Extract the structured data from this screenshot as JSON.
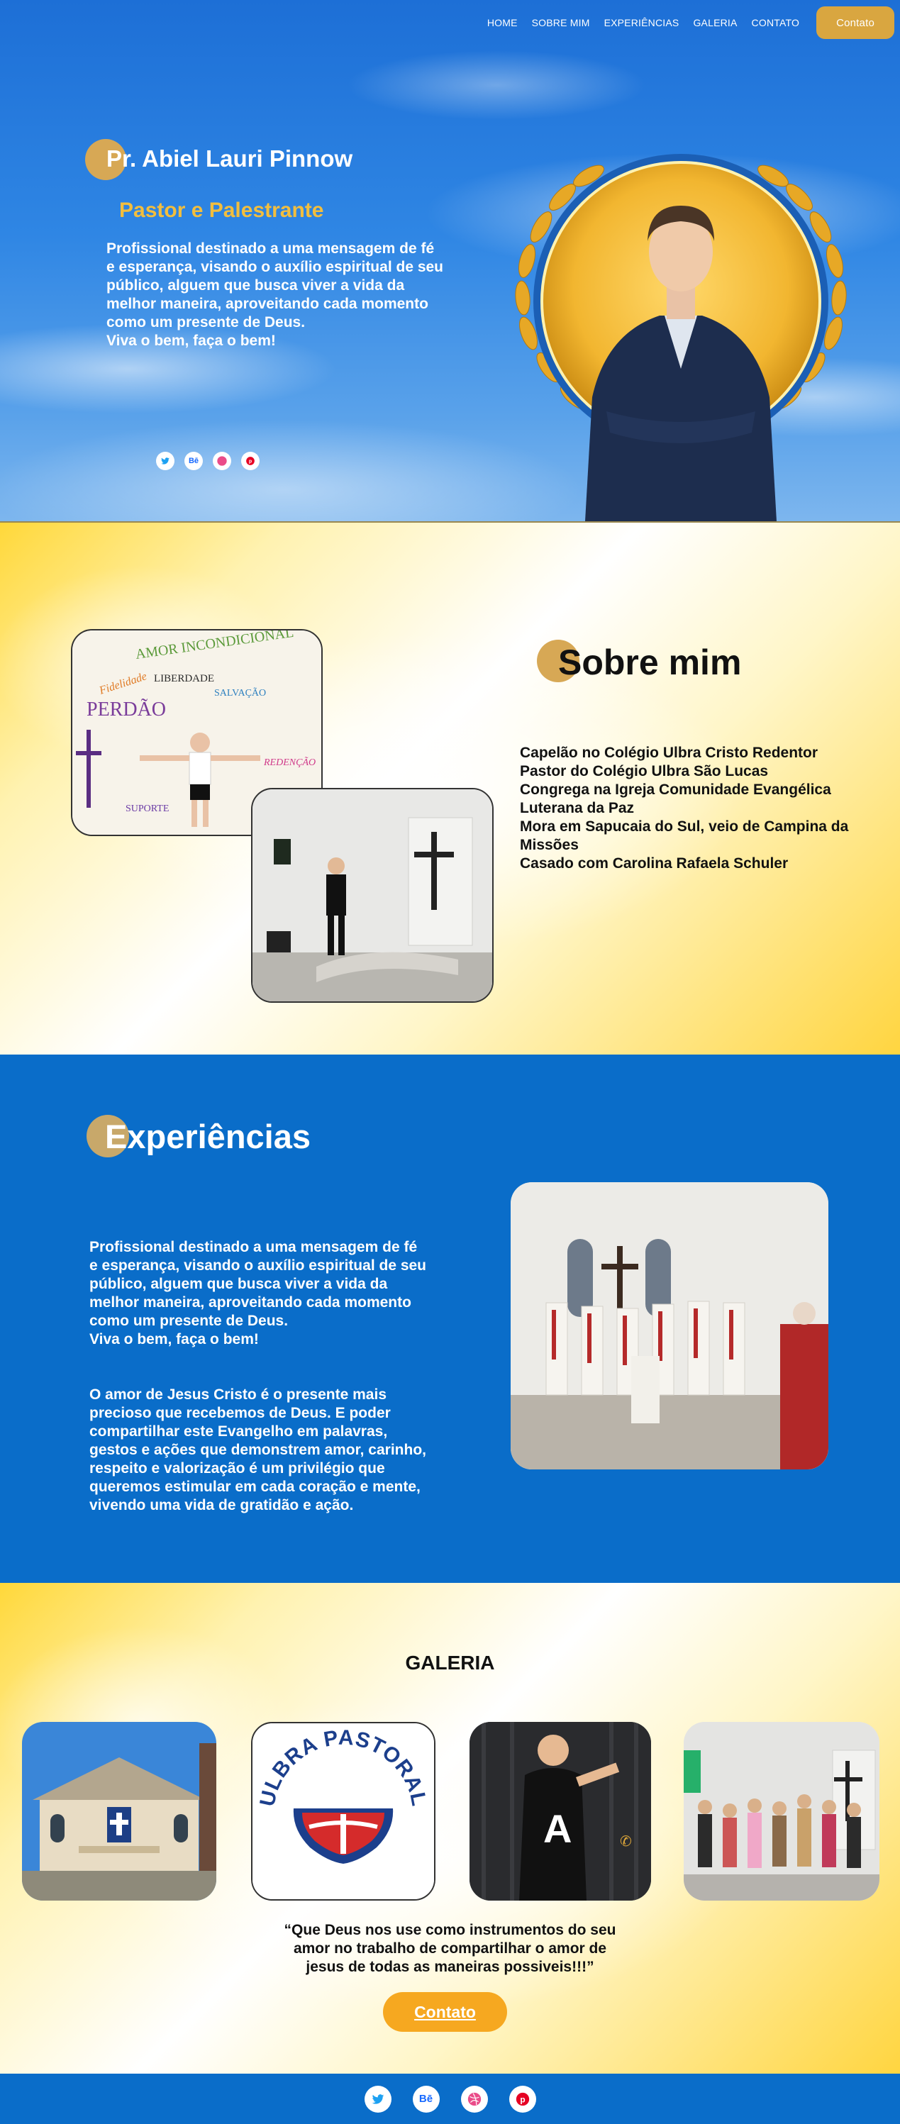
{
  "nav": {
    "items": [
      "HOME",
      "SOBRE MIM",
      "EXPERIÊNCIAS",
      "GALERIA",
      "CONTATO"
    ],
    "contact_button": "Contato"
  },
  "hero": {
    "name": "Pr. Abiel Lauri Pinnow",
    "role": "Pastor e Palestrante",
    "description": "Profissional destinado a uma mensagem de fé\ne esperança, visando o auxílio espiritual de seu\npúblico, alguem que busca viver a vida da\nmelhor maneira, aproveitando cada momento\ncomo um presente de Deus.\nViva o bem, faça o bem!",
    "social_icons": [
      "twitter-icon",
      "behance-icon",
      "dribbble-icon",
      "pinterest-icon"
    ]
  },
  "sobre": {
    "title": "Sobre mim",
    "items": [
      "Capelão no Colégio Ulbra Cristo Redentor",
      "Pastor do Colégio Ulbra São Lucas",
      "Congrega na Igreja Comunidade Evangélica Luterana da Paz",
      "Mora em Sapucaia do Sul, veio de Campina da Missões",
      "Casado com Carolina Rafaela Schuler"
    ],
    "wall_words": [
      "AMOR INCONDICIONAL",
      "LIBERDADE",
      "PERDÃO",
      "Fidelidade",
      "SALVAÇÃO",
      "REDENÇÃO",
      "SUPORTE"
    ]
  },
  "experiencias": {
    "title": "Experiências",
    "paragraph1": "Profissional destinado a uma mensagem de fé\ne esperança, visando o auxílio espiritual de seu\npúblico, alguem que busca viver a vida da\nmelhor maneira, aproveitando cada momento\ncomo um presente de Deus.\nViva o bem, faça o bem!",
    "paragraph2": "O amor de Jesus Cristo é o presente mais\nprecioso que recebemos de Deus. E poder\ncompartilhar este Evangelho em palavras,\ngestos e ações que demonstrem amor, carinho,\nrespeito e valorização é um privilégio que\nqueremos estimular em cada coração e mente,\nvivendo uma vida de gratidão e ação."
  },
  "galeria": {
    "title": "GALERIA",
    "logo_text": "ULBRA PASTORAL",
    "quote": "“Que Deus nos use como instrumentos do seu\namor no trabalho de compartilhar o amor de\njesus de todas as maneiras possiveis!!!”",
    "button": "Contato"
  },
  "colors": {
    "brand_blue": "#0a6dc9",
    "gold": "#d9a640",
    "accent_orange": "#f6a820",
    "role_yellow": "#f2be3e"
  }
}
